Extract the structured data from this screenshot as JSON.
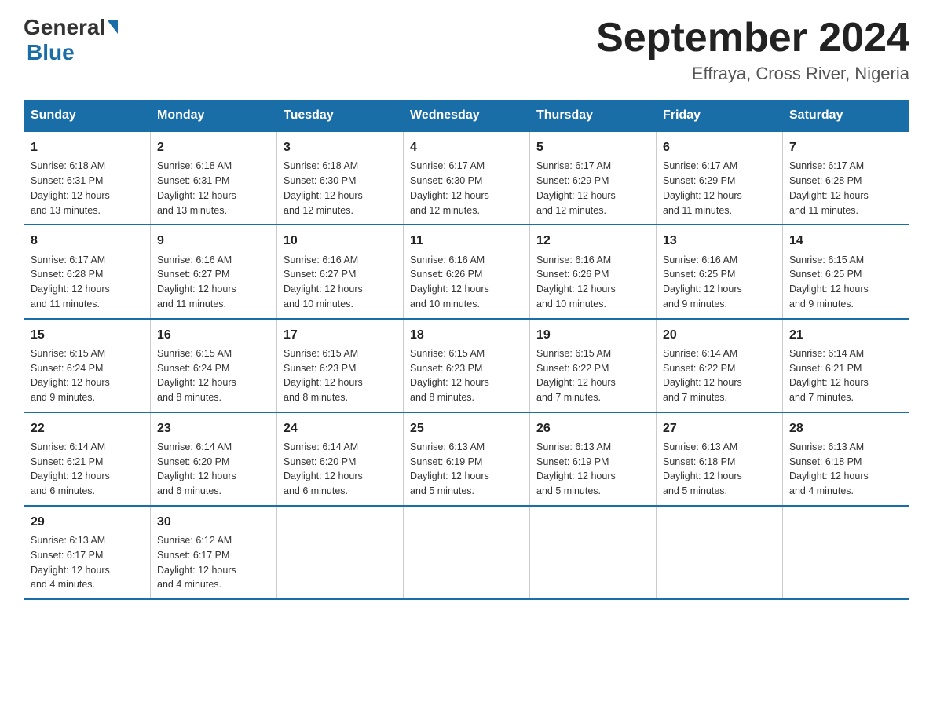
{
  "logo": {
    "general_text": "General",
    "blue_text": "Blue"
  },
  "title": "September 2024",
  "subtitle": "Effraya, Cross River, Nigeria",
  "days": [
    "Sunday",
    "Monday",
    "Tuesday",
    "Wednesday",
    "Thursday",
    "Friday",
    "Saturday"
  ],
  "weeks": [
    [
      {
        "day": "1",
        "sunrise": "6:18 AM",
        "sunset": "6:31 PM",
        "daylight": "12 hours and 13 minutes."
      },
      {
        "day": "2",
        "sunrise": "6:18 AM",
        "sunset": "6:31 PM",
        "daylight": "12 hours and 13 minutes."
      },
      {
        "day": "3",
        "sunrise": "6:18 AM",
        "sunset": "6:30 PM",
        "daylight": "12 hours and 12 minutes."
      },
      {
        "day": "4",
        "sunrise": "6:17 AM",
        "sunset": "6:30 PM",
        "daylight": "12 hours and 12 minutes."
      },
      {
        "day": "5",
        "sunrise": "6:17 AM",
        "sunset": "6:29 PM",
        "daylight": "12 hours and 12 minutes."
      },
      {
        "day": "6",
        "sunrise": "6:17 AM",
        "sunset": "6:29 PM",
        "daylight": "12 hours and 11 minutes."
      },
      {
        "day": "7",
        "sunrise": "6:17 AM",
        "sunset": "6:28 PM",
        "daylight": "12 hours and 11 minutes."
      }
    ],
    [
      {
        "day": "8",
        "sunrise": "6:17 AM",
        "sunset": "6:28 PM",
        "daylight": "12 hours and 11 minutes."
      },
      {
        "day": "9",
        "sunrise": "6:16 AM",
        "sunset": "6:27 PM",
        "daylight": "12 hours and 11 minutes."
      },
      {
        "day": "10",
        "sunrise": "6:16 AM",
        "sunset": "6:27 PM",
        "daylight": "12 hours and 10 minutes."
      },
      {
        "day": "11",
        "sunrise": "6:16 AM",
        "sunset": "6:26 PM",
        "daylight": "12 hours and 10 minutes."
      },
      {
        "day": "12",
        "sunrise": "6:16 AM",
        "sunset": "6:26 PM",
        "daylight": "12 hours and 10 minutes."
      },
      {
        "day": "13",
        "sunrise": "6:16 AM",
        "sunset": "6:25 PM",
        "daylight": "12 hours and 9 minutes."
      },
      {
        "day": "14",
        "sunrise": "6:15 AM",
        "sunset": "6:25 PM",
        "daylight": "12 hours and 9 minutes."
      }
    ],
    [
      {
        "day": "15",
        "sunrise": "6:15 AM",
        "sunset": "6:24 PM",
        "daylight": "12 hours and 9 minutes."
      },
      {
        "day": "16",
        "sunrise": "6:15 AM",
        "sunset": "6:24 PM",
        "daylight": "12 hours and 8 minutes."
      },
      {
        "day": "17",
        "sunrise": "6:15 AM",
        "sunset": "6:23 PM",
        "daylight": "12 hours and 8 minutes."
      },
      {
        "day": "18",
        "sunrise": "6:15 AM",
        "sunset": "6:23 PM",
        "daylight": "12 hours and 8 minutes."
      },
      {
        "day": "19",
        "sunrise": "6:15 AM",
        "sunset": "6:22 PM",
        "daylight": "12 hours and 7 minutes."
      },
      {
        "day": "20",
        "sunrise": "6:14 AM",
        "sunset": "6:22 PM",
        "daylight": "12 hours and 7 minutes."
      },
      {
        "day": "21",
        "sunrise": "6:14 AM",
        "sunset": "6:21 PM",
        "daylight": "12 hours and 7 minutes."
      }
    ],
    [
      {
        "day": "22",
        "sunrise": "6:14 AM",
        "sunset": "6:21 PM",
        "daylight": "12 hours and 6 minutes."
      },
      {
        "day": "23",
        "sunrise": "6:14 AM",
        "sunset": "6:20 PM",
        "daylight": "12 hours and 6 minutes."
      },
      {
        "day": "24",
        "sunrise": "6:14 AM",
        "sunset": "6:20 PM",
        "daylight": "12 hours and 6 minutes."
      },
      {
        "day": "25",
        "sunrise": "6:13 AM",
        "sunset": "6:19 PM",
        "daylight": "12 hours and 5 minutes."
      },
      {
        "day": "26",
        "sunrise": "6:13 AM",
        "sunset": "6:19 PM",
        "daylight": "12 hours and 5 minutes."
      },
      {
        "day": "27",
        "sunrise": "6:13 AM",
        "sunset": "6:18 PM",
        "daylight": "12 hours and 5 minutes."
      },
      {
        "day": "28",
        "sunrise": "6:13 AM",
        "sunset": "6:18 PM",
        "daylight": "12 hours and 4 minutes."
      }
    ],
    [
      {
        "day": "29",
        "sunrise": "6:13 AM",
        "sunset": "6:17 PM",
        "daylight": "12 hours and 4 minutes."
      },
      {
        "day": "30",
        "sunrise": "6:12 AM",
        "sunset": "6:17 PM",
        "daylight": "12 hours and 4 minutes."
      },
      null,
      null,
      null,
      null,
      null
    ]
  ],
  "labels": {
    "sunrise": "Sunrise:",
    "sunset": "Sunset:",
    "daylight": "Daylight:"
  }
}
